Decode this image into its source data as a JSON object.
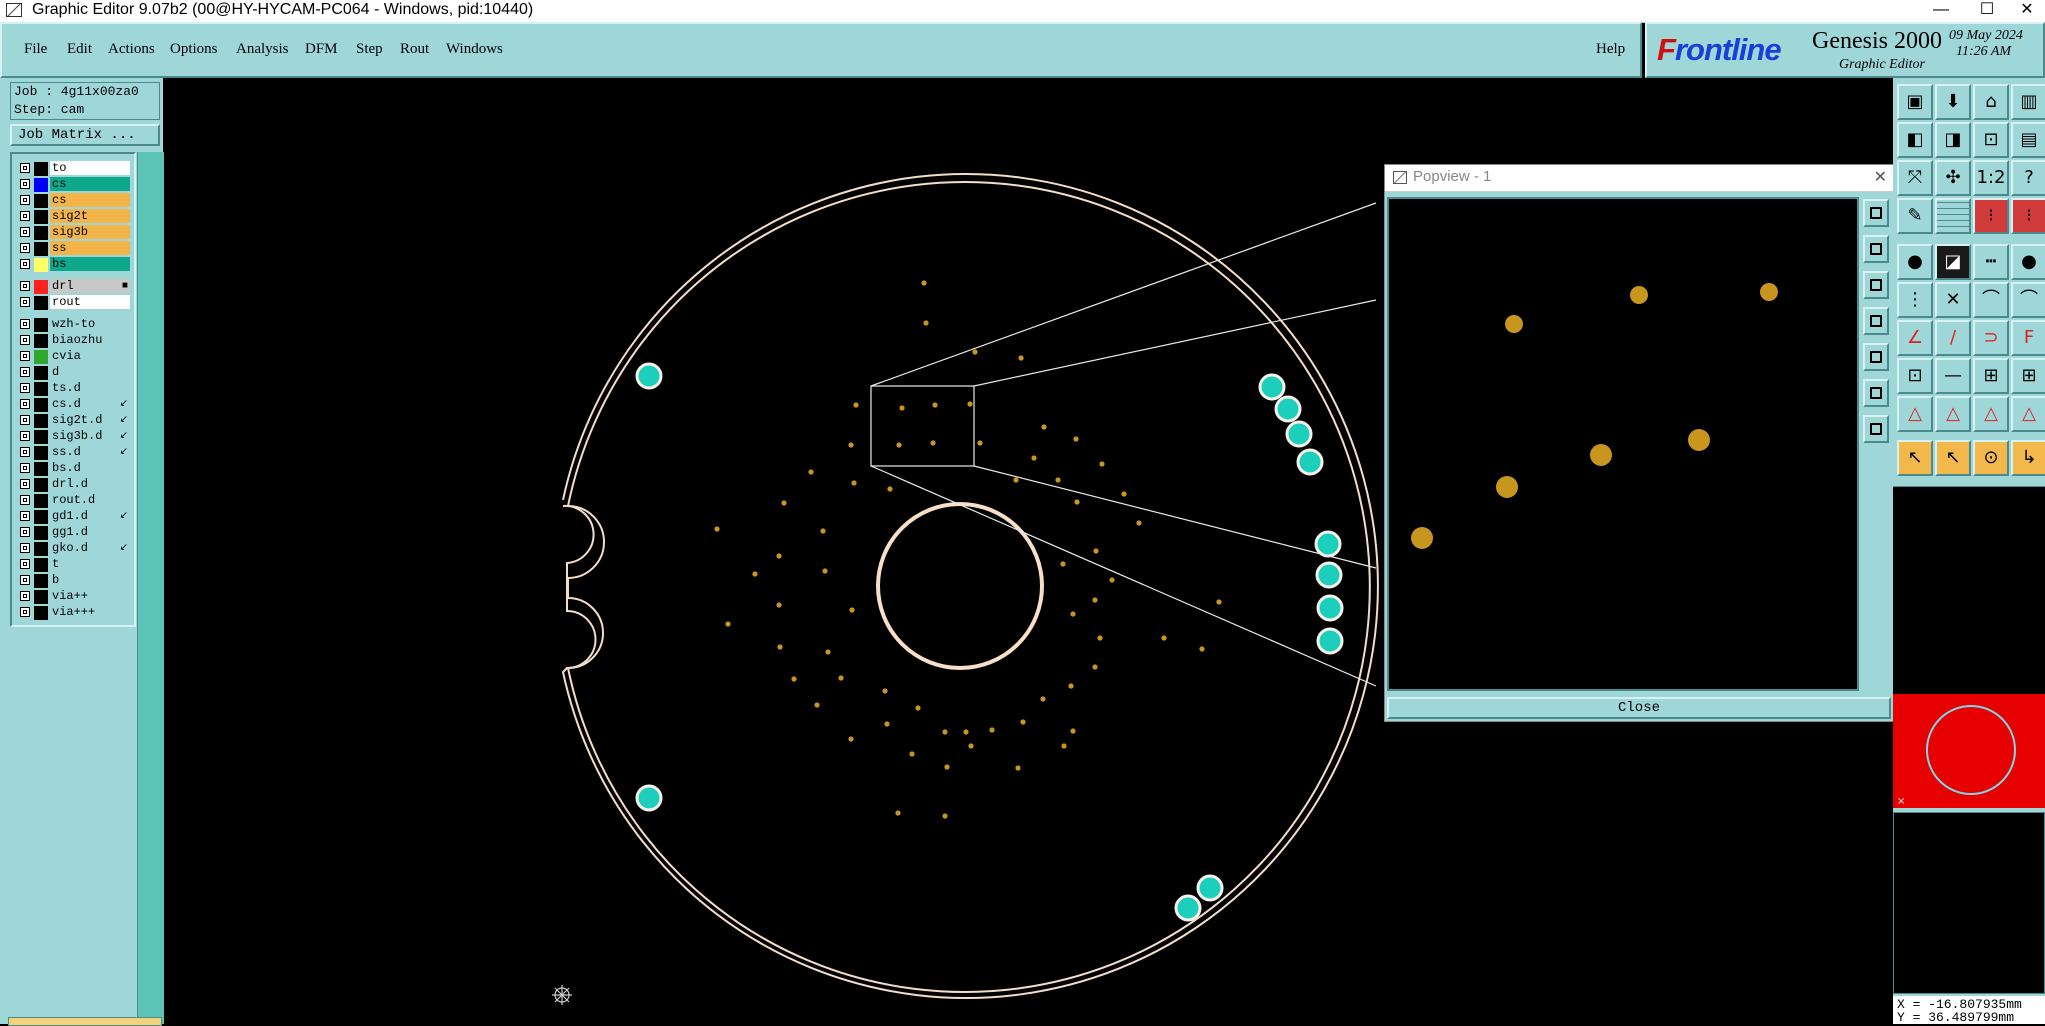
{
  "window": {
    "title": "Graphic Editor 9.07b2 (00@HY-HYCAM-PC064 - Windows, pid:10440)",
    "minimize": "—",
    "maximize": "☐",
    "close": "✕"
  },
  "menu": {
    "items": [
      "File",
      "Edit",
      "Actions",
      "Options",
      "Analysis",
      "DFM",
      "Step",
      "Rout",
      "Windows"
    ],
    "help": "Help"
  },
  "brand": {
    "logo_prefix": "F",
    "logo_rest": "rontline",
    "product": "Genesis 2000",
    "subtitle": "Graphic Editor",
    "date": "09 May 2024",
    "time": "11:26 AM"
  },
  "job": {
    "job_line": "Job : 4g11x00za0",
    "step_line": "Step: cam",
    "matrix_button": "Job Matrix ..."
  },
  "layers": [
    {
      "name": "to",
      "swatch": "#000000",
      "label_bg": "#ffffff"
    },
    {
      "name": "cs",
      "swatch": "#0000ff",
      "label_bg": "#0ea88a"
    },
    {
      "name": "cs",
      "swatch": "#000000",
      "label_bg": "#f3b54a"
    },
    {
      "name": "sig2t",
      "swatch": "#000000",
      "label_bg": "#f3b54a"
    },
    {
      "name": "sig3b",
      "swatch": "#000000",
      "label_bg": "#f3b54a"
    },
    {
      "name": "ss",
      "swatch": "#000000",
      "label_bg": "#f3b54a"
    },
    {
      "name": "bs",
      "swatch": "#ffff66",
      "label_bg": "#0ea88a"
    },
    {
      "name": "drl",
      "swatch": "#ff2020",
      "label_bg": "#c8c8c8",
      "mark": "■"
    },
    {
      "name": "rout",
      "swatch": "#000000",
      "label_bg": "#ffffff"
    },
    {
      "name": "wzh-to",
      "swatch": "#000000",
      "label_bg": "#9fd7d9"
    },
    {
      "name": "biaozhu",
      "swatch": "#000000",
      "label_bg": "#9fd7d9"
    },
    {
      "name": "cvia",
      "swatch": "#2fa830",
      "label_bg": "#9fd7d9"
    },
    {
      "name": "d",
      "swatch": "#000000",
      "label_bg": "#9fd7d9"
    },
    {
      "name": "ts.d",
      "swatch": "#000000",
      "label_bg": "#9fd7d9"
    },
    {
      "name": "cs.d",
      "swatch": "#000000",
      "label_bg": "#9fd7d9",
      "mark": "↙"
    },
    {
      "name": "sig2t.d",
      "swatch": "#000000",
      "label_bg": "#9fd7d9",
      "mark": "↙"
    },
    {
      "name": "sig3b.d",
      "swatch": "#000000",
      "label_bg": "#9fd7d9",
      "mark": "↙"
    },
    {
      "name": "ss.d",
      "swatch": "#000000",
      "label_bg": "#9fd7d9",
      "mark": "↙"
    },
    {
      "name": "bs.d",
      "swatch": "#000000",
      "label_bg": "#9fd7d9"
    },
    {
      "name": "drl.d",
      "swatch": "#000000",
      "label_bg": "#9fd7d9"
    },
    {
      "name": "rout.d",
      "swatch": "#000000",
      "label_bg": "#9fd7d9"
    },
    {
      "name": "gd1.d",
      "swatch": "#000000",
      "label_bg": "#9fd7d9",
      "mark": "↙"
    },
    {
      "name": "gg1.d",
      "swatch": "#000000",
      "label_bg": "#9fd7d9"
    },
    {
      "name": "gko.d",
      "swatch": "#000000",
      "label_bg": "#9fd7d9",
      "mark": "↙"
    },
    {
      "name": "t",
      "swatch": "#000000",
      "label_bg": "#9fd7d9"
    },
    {
      "name": "b",
      "swatch": "#000000",
      "label_bg": "#9fd7d9"
    },
    {
      "name": "via++",
      "swatch": "#000000",
      "label_bg": "#9fd7d9"
    },
    {
      "name": "via+++",
      "swatch": "#000000",
      "label_bg": "#9fd7d9"
    }
  ],
  "popview": {
    "title": "Popview - 1",
    "close_button": "Close",
    "close_x": "✕"
  },
  "status": {
    "x_readout": "X = -16.807935mm",
    "y_readout": "Y = 36.489799mm"
  },
  "colors": {
    "panel": "#9fd7d9",
    "pad_cyan": "#1ccfbd",
    "drill_gold": "#c8961e",
    "outline": "#f4ddc8",
    "overview_red": "#e60000"
  },
  "icons": {
    "toolbar_rows": [
      [
        "layers-icon",
        "save-icon",
        "home-icon",
        "window-icon"
      ],
      [
        "zoom-left-icon",
        "zoom-right-icon",
        "fit-icon",
        "split-icon"
      ],
      [
        "fit-screen-icon",
        "zoom-fit-icon",
        "scale-1-2-icon",
        "help-icon"
      ],
      [
        "measure-icon",
        "grid-icon",
        "snap-red-icon",
        "snap-red2-icon"
      ],
      [
        "pad-icon",
        "line-red-icon",
        "dash-icon",
        "dot-icon"
      ],
      [
        "connect-icon",
        "cross-icon",
        "arc-icon",
        "pad-arc-icon"
      ],
      [
        "line-add-icon",
        "slash-icon",
        "arc-add-icon",
        "text-icon"
      ],
      [
        "pad-select-icon",
        "minus-icon",
        "move-icon",
        "group-icon"
      ],
      [
        "triangle-icon",
        "triangle2-icon",
        "triangle3-icon",
        "triangle4-icon"
      ],
      [
        "pointer-icon",
        "pointer-select-icon",
        "pointer-circle-icon",
        "pointer-move-icon"
      ]
    ]
  }
}
